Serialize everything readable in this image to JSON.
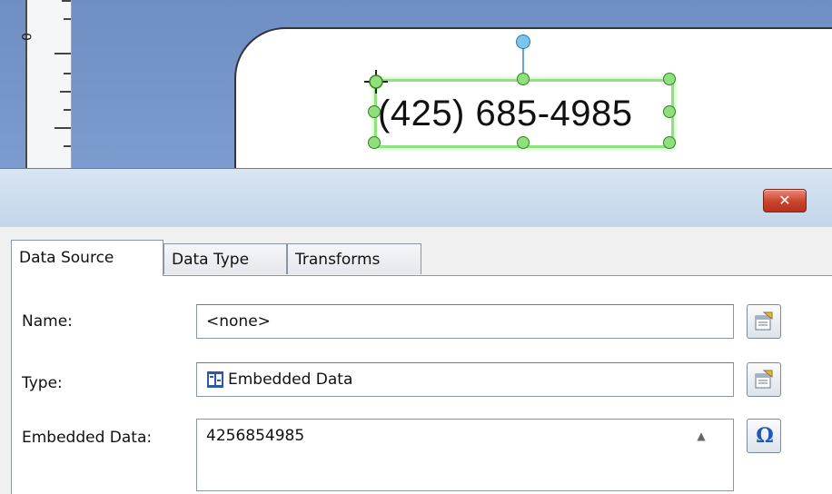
{
  "canvas": {
    "ruler_label": "0",
    "shape_text": "(425) 685-4985"
  },
  "dialog": {
    "close_glyph": "✕",
    "tabs": [
      {
        "label": "Data Source",
        "active": true
      },
      {
        "label": "Data Type",
        "active": false
      },
      {
        "label": "Transforms",
        "active": false
      }
    ],
    "fields": {
      "name_label": "Name:",
      "name_value": "<none>",
      "type_label": "Type:",
      "type_value": "Embedded Data",
      "embedded_label": "Embedded Data:",
      "embedded_value": "4256854985"
    },
    "icons": {
      "name_button": "properties-icon",
      "type_button": "properties-icon",
      "embedded_button": "omega-icon",
      "type_value_icon": "embedded-data-icon"
    },
    "omega_glyph": "Ω"
  },
  "colors": {
    "canvas_bg": "#7592c8",
    "selection": "#8fe27d",
    "close_button": "#c9432c",
    "title_bar": "#cddcec"
  }
}
